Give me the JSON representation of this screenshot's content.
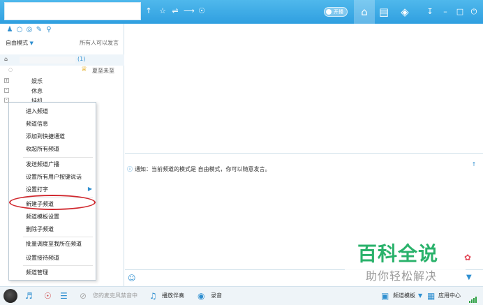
{
  "titlebar": {
    "toolbar_icons": [
      "share-arrow-icon",
      "star-icon",
      "transfer-icon",
      "share-icon",
      "shield-icon"
    ],
    "toggle_label": "开播",
    "nav_icons": [
      "home-icon",
      "list-icon",
      "gamepad-icon"
    ],
    "window_icons": [
      "download-icon",
      "minimize-icon",
      "maximize-icon",
      "power-icon"
    ]
  },
  "left_panel": {
    "mode_label": "自由模式",
    "speak_permission": "所有人可以发言",
    "channel_root_count": "(1)",
    "user_status": "夏至未至",
    "tree_items": [
      "娱乐",
      "休息",
      "挂机"
    ]
  },
  "context_menu": {
    "items": [
      "进入频道",
      "频道信息",
      "添加到快捷通道",
      "收起所有频道",
      "发送频道广播",
      "设置所有用户按键说话",
      "设置打字",
      "新建子频道",
      "频道模板设置",
      "删除子频道",
      "批量调度至我所在频道",
      "设置接待频道",
      "频道管理"
    ]
  },
  "chat": {
    "notice": "通知：当前频道的模式是 自由模式，你可以随意发言。"
  },
  "watermark": {
    "big": "百科全说",
    "small": "助你轻松解决"
  },
  "bottombar": {
    "mic_status": "您的麦克风禁音中",
    "play_accompaniment": "播放伴奏",
    "record": "录音",
    "channel_template": "频道模板",
    "app_center": "应用中心"
  },
  "colors": {
    "titlebar": "#2f9fe0",
    "accent": "#2f8fd0",
    "highlight_ring": "#d0282e",
    "watermark_green": "#2ab26b"
  }
}
